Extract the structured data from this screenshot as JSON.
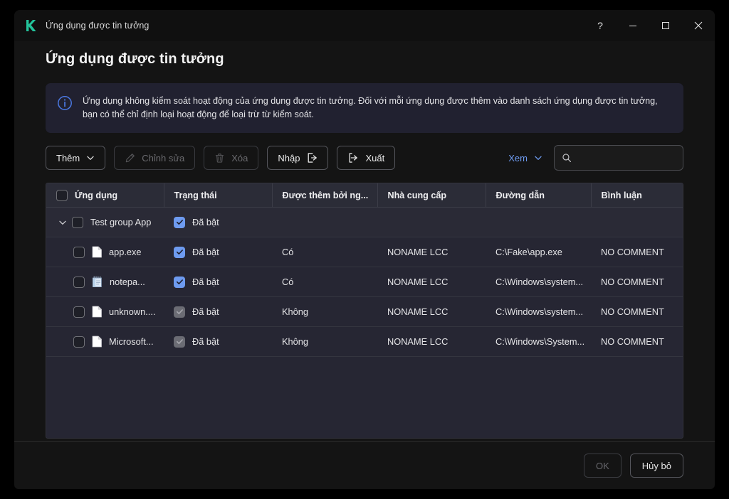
{
  "window": {
    "titlebar_title": "Ứng dụng được tin tưởng",
    "logo": "kaspersky-k-logo",
    "controls": {
      "help": "?",
      "minimize": "minimize-icon",
      "maximize": "maximize-icon",
      "close": "close-icon"
    }
  },
  "page": {
    "title": "Ứng dụng được tin tưởng"
  },
  "banner": {
    "icon": "info-icon",
    "text": "Ứng dụng không kiểm soát hoạt động của ứng dụng được tin tưởng. Đối với mỗi ứng dụng được thêm vào danh sách ứng dụng được tin tưởng, bạn có thể chỉ định loại hoạt động để loại trừ từ kiểm soát."
  },
  "toolbar": {
    "add_label": "Thêm",
    "add_icon": "chevron-down-icon",
    "edit_label": "Chỉnh sửa",
    "edit_icon": "pencil-icon",
    "edit_disabled": true,
    "delete_label": "Xóa",
    "delete_icon": "trash-icon",
    "delete_disabled": true,
    "import_label": "Nhập",
    "import_icon": "import-icon",
    "export_label": "Xuất",
    "export_icon": "export-icon",
    "view_label": "Xem",
    "view_icon": "chevron-down-icon",
    "search_icon": "search-icon",
    "search_value": "",
    "search_placeholder": ""
  },
  "table": {
    "columns": [
      "Ứng dụng",
      "Trạng thái",
      "Được thêm bởi ng...",
      "Nhà cung cấp",
      "Đường dẫn",
      "Bình luận",
      ""
    ],
    "header_checkbox": {
      "checked": false
    },
    "rows": [
      {
        "type": "group",
        "expander": "chevron-down-icon",
        "checkbox": {
          "checked": false
        },
        "name": "Test group App",
        "status_checkbox": {
          "checked": true,
          "dim": false
        },
        "status": "Đã bật",
        "added_by_user": "",
        "vendor": "",
        "path": "",
        "comment": ""
      },
      {
        "type": "item",
        "checkbox": {
          "checked": false
        },
        "icon": "file-icon",
        "name": "app.exe",
        "status_checkbox": {
          "checked": true,
          "dim": false
        },
        "status": "Đã bật",
        "added_by_user": "Có",
        "vendor": "NONAME LCC",
        "path": "C:\\Fake\\app.exe",
        "comment": "NO COMMENT"
      },
      {
        "type": "item",
        "checkbox": {
          "checked": false
        },
        "icon": "notepad-icon",
        "name": "notepa...",
        "status_checkbox": {
          "checked": true,
          "dim": false
        },
        "status": "Đã bật",
        "added_by_user": "Có",
        "vendor": "NONAME LCC",
        "path": "C:\\Windows\\system...",
        "comment": "NO COMMENT"
      },
      {
        "type": "item",
        "checkbox": {
          "checked": false
        },
        "icon": "file-icon",
        "name": "unknown....",
        "status_checkbox": {
          "checked": true,
          "dim": true
        },
        "status": "Đã bật",
        "added_by_user": "Không",
        "vendor": "NONAME LCC",
        "path": "C:\\Windows\\system...",
        "comment": "NO COMMENT"
      },
      {
        "type": "item",
        "checkbox": {
          "checked": false
        },
        "icon": "file-icon",
        "name": "Microsoft...",
        "status_checkbox": {
          "checked": true,
          "dim": true
        },
        "status": "Đã bật",
        "added_by_user": "Không",
        "vendor": "NONAME LCC",
        "path": "C:\\Windows\\System...",
        "comment": "NO COMMENT"
      }
    ]
  },
  "footer": {
    "ok_label": "OK",
    "ok_disabled": true,
    "cancel_label": "Hủy bỏ"
  },
  "colors": {
    "accent_blue": "#6e9bf0",
    "brand_green": "#23c39b",
    "dialog_bg": "#141414",
    "table_bg": "#262633",
    "header_bg": "#2b2c37"
  }
}
